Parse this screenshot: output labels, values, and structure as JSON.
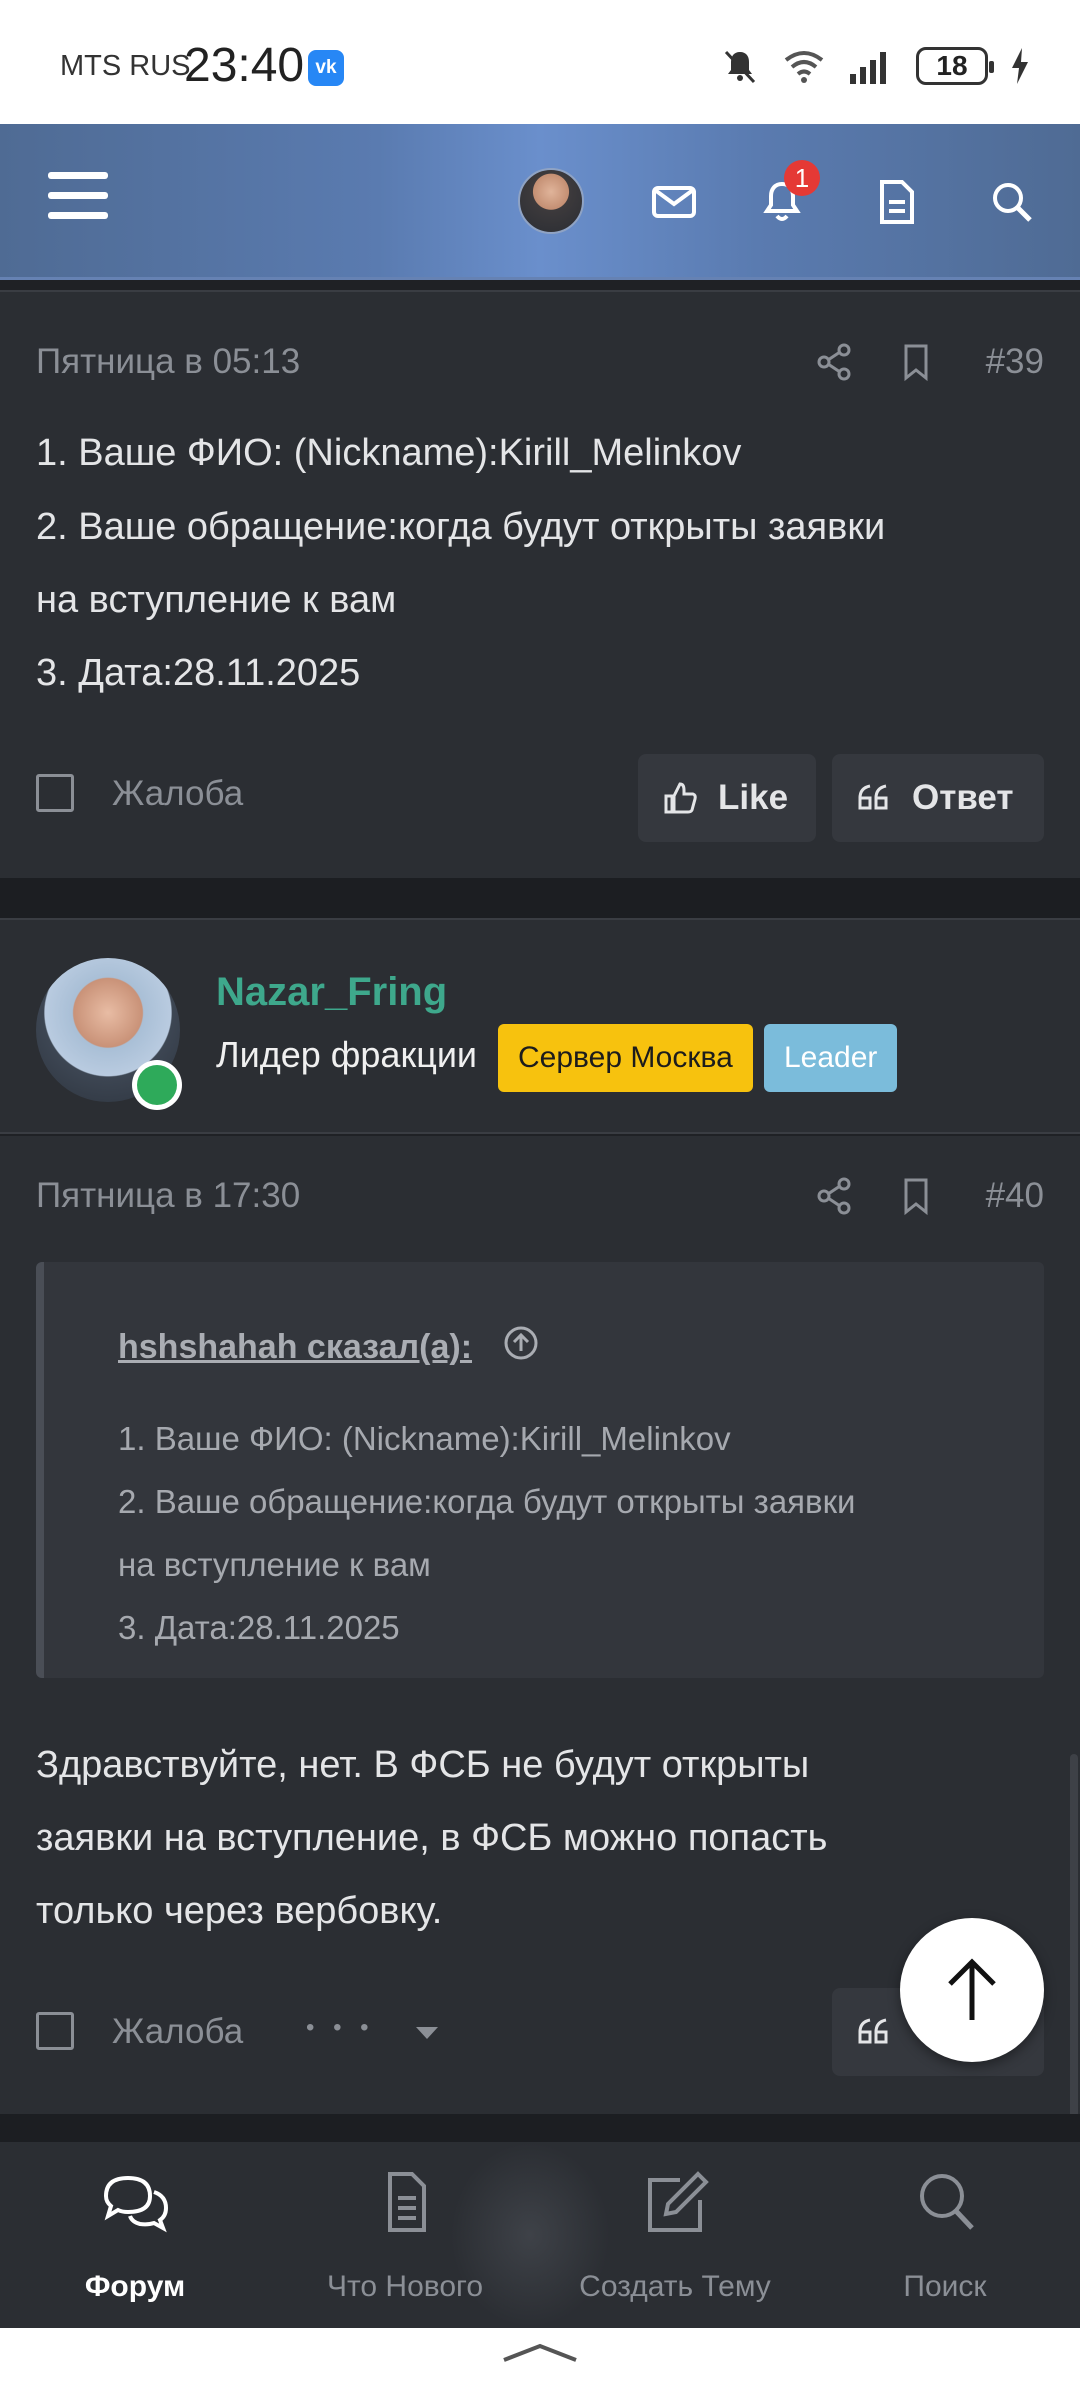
{
  "status_bar": {
    "carrier": "MTS RUS",
    "time": "23:40",
    "app_icon": "vk-icon",
    "app_icon_text": "vk",
    "battery": "18"
  },
  "header": {
    "notification_count": "1"
  },
  "post1": {
    "date": "Пятница в 05:13",
    "number": "#39",
    "lines": [
      "1. Ваше ФИО: (Nickname):Kirill_Melinkov",
      "2. Ваше обращение:когда будут открыты заявки",
      "на вступление к вам",
      "3. Дата:28.11.2025"
    ],
    "report_label": "Жалоба",
    "like_label": "Like",
    "reply_label": "Ответ"
  },
  "user": {
    "name": "Nazar_Fring",
    "title": "Лидер фракции",
    "tag_server": "Сервер Москва",
    "tag_role": "Leader"
  },
  "post2": {
    "date": "Пятница в 17:30",
    "number": "#40",
    "quote_author": "hshshahah сказал(а):",
    "quote_lines": [
      "1. Ваше ФИО: (Nickname):Kirill_Melinkov",
      "2. Ваше обращение:когда будут открыты заявки",
      "на вступление к вам",
      "3. Дата:28.11.2025"
    ],
    "lines": [
      "Здравствуйте, нет. В ФСБ не будут открыты",
      "заявки на вступление, в ФСБ можно попасть",
      "только через вербовку."
    ],
    "report_label": "Жалоба",
    "more_dots": "• • •"
  },
  "bottom_nav": [
    {
      "label": "Форум",
      "icon": "forum-icon",
      "active": true
    },
    {
      "label": "Что Нового",
      "icon": "document-icon",
      "active": false
    },
    {
      "label": "Создать Тему",
      "icon": "edit-icon",
      "active": false
    },
    {
      "label": "Поиск",
      "icon": "search-icon",
      "active": false
    }
  ],
  "colors": {
    "username": "#3ea88c",
    "tag_server": "#f7c20e",
    "tag_role": "#7bbcdb",
    "badge": "#e53935"
  }
}
